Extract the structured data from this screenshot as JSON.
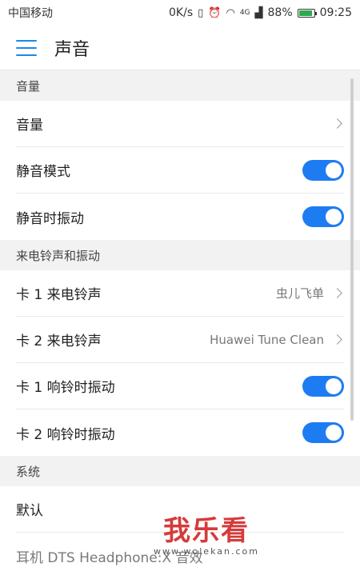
{
  "status_bar": {
    "carrier": "中国移动",
    "speed": "0K/s",
    "network": "4G",
    "battery_percent": "88%",
    "battery_level": 0.88,
    "time": "09:25",
    "icons": [
      "vibrate-icon",
      "alarm-icon",
      "wifi-icon",
      "signal-icon",
      "battery-icon"
    ]
  },
  "app_bar": {
    "title": "声音"
  },
  "sections": {
    "volume": {
      "header": "音量",
      "rows": {
        "volume": {
          "label": "音量"
        },
        "silent_mode": {
          "label": "静音模式",
          "enabled": true
        },
        "vibrate_when_silent": {
          "label": "静音时振动",
          "enabled": true
        }
      }
    },
    "ringtone": {
      "header": "来电铃声和振动",
      "rows": {
        "card1_ringtone": {
          "label": "卡 1 来电铃声",
          "value": "虫儿飞单"
        },
        "card2_ringtone": {
          "label": "卡 2 来电铃声",
          "value": "Huawei Tune Clean"
        },
        "card1_vibrate": {
          "label": "卡 1 响铃时振动",
          "enabled": true
        },
        "card2_vibrate": {
          "label": "卡 2 响铃时振动",
          "enabled": true
        }
      }
    },
    "system": {
      "header": "系统",
      "rows": {
        "default": {
          "label": "默认"
        },
        "headphone": {
          "label": "耳机 DTS Headphone:X 音效"
        }
      }
    }
  },
  "watermark": {
    "logo": "我乐看",
    "url": "www.wolekan.com"
  },
  "colors": {
    "accent": "#1e7cf2",
    "background": "#f4f4f4"
  }
}
